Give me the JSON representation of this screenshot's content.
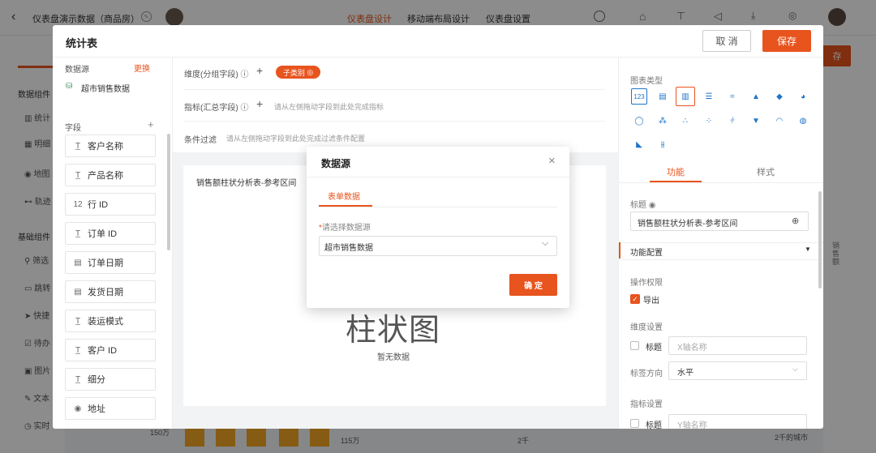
{
  "app": {
    "title": "仪表盘演示数据（商品房）",
    "tabs": [
      "仪表盘设计",
      "移动端布局设计",
      "仪表盘设置"
    ],
    "background_save": "存",
    "sidebar": {
      "group1": "数据组件",
      "items1": [
        "统计",
        "明细",
        "地图",
        "轨迹"
      ],
      "group2": "基础组件",
      "items2": [
        "筛选",
        "跳转",
        "快捷",
        "待办",
        "图片",
        "文本",
        "实时"
      ]
    },
    "bottom": {
      "y_label": "150万",
      "x_label": "115万",
      "mid_label": "2千",
      "right_label": "2千的城市"
    },
    "right_edge_text": "销售额"
  },
  "dialog": {
    "title": "统计表",
    "cancel": "取 消",
    "save": "保存",
    "datasource_label": "数据源",
    "change_label": "更换",
    "datasource_name": "超市销售数据",
    "fields_label": "字段",
    "add_symbol": "+",
    "fields": [
      {
        "icon": "T",
        "name": "客户名称"
      },
      {
        "icon": "T",
        "name": "产品名称"
      },
      {
        "icon": "12",
        "name": "行 ID"
      },
      {
        "icon": "T",
        "name": "订单 ID"
      },
      {
        "icon": "cal",
        "name": "订单日期"
      },
      {
        "icon": "cal",
        "name": "发货日期"
      },
      {
        "icon": "T",
        "name": "装运模式"
      },
      {
        "icon": "T",
        "name": "客户 ID"
      },
      {
        "icon": "T",
        "name": "细分"
      },
      {
        "icon": "loc",
        "name": "地址"
      }
    ],
    "dimension_label": "维度(分组字段)",
    "dimension_chip": "子类别",
    "metric_label": "指标(汇总字段)",
    "metric_hint": "请从左侧拖动字段到此处完成指标",
    "filter_label": "条件过滤",
    "filter_hint": "请从左侧拖动字段到此处完成过滤条件配置",
    "chart_title": "销售额柱状分析表-参考区间",
    "chart_placeholder": "柱状图",
    "no_data": "暂无数据",
    "chart_type_label": "图表类型",
    "tab_function": "功能",
    "tab_style": "样式",
    "title_label": "标题",
    "title_value": "销售额柱状分析表-参考区间",
    "func_config": "功能配置",
    "permission_label": "操作权限",
    "export_label": "导出",
    "dim_settings": "维度设置",
    "title_check": "标题",
    "x_axis_placeholder": "X轴名称",
    "label_direction": "标签方向",
    "direction_value": "水平",
    "metric_settings": "指标设置",
    "y_axis_placeholder": "Y轴名称"
  },
  "modal": {
    "title": "数据源",
    "tab": "表单数据",
    "required_mark": "*",
    "select_label": "请选择数据源",
    "select_value": "超市销售数据",
    "confirm": "确 定"
  },
  "colors": {
    "accent": "#e8541e",
    "chart_icon": "#1f74c9"
  }
}
